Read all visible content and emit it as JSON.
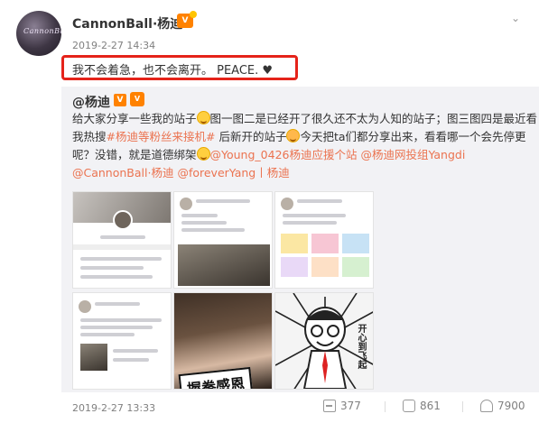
{
  "post": {
    "author": "CannonBall·杨迪",
    "avatar_signature": "CannonBall",
    "timestamp": "2019-2-27 14:34",
    "status_text": "我不会着急，也不会离开。 PEACE. ♥",
    "menu_icon": "chevron-down-icon"
  },
  "repost": {
    "author": "@杨迪",
    "line1": "给大家分享一些我的站子",
    "line1b": "图一图二是已经开了很久还不太为人知的站子；图三图四是最近看",
    "line2a": "我热搜",
    "line2_link": "#杨迪等粉丝来接机#",
    "line2b": " 后新开的站子",
    "line2c": "今天把ta们都分享出来，看看哪一个会先停更",
    "line3a": "呢？没错，就是道德绑架",
    "line3_mention1": "@Young_0426杨迪应援个站",
    "line3_mention2": "@杨迪网投组Yangdi",
    "line4_mention1": "@CannonBall·杨迪",
    "line4_mention2": "@foreverYang丨杨迪",
    "image6_caption": "开心到飞起",
    "image5_caption": "握拳感恩",
    "timestamp": "2019-2-27 13:33"
  },
  "footer": {
    "shares": "377",
    "comments": "861",
    "likes": "7900"
  }
}
